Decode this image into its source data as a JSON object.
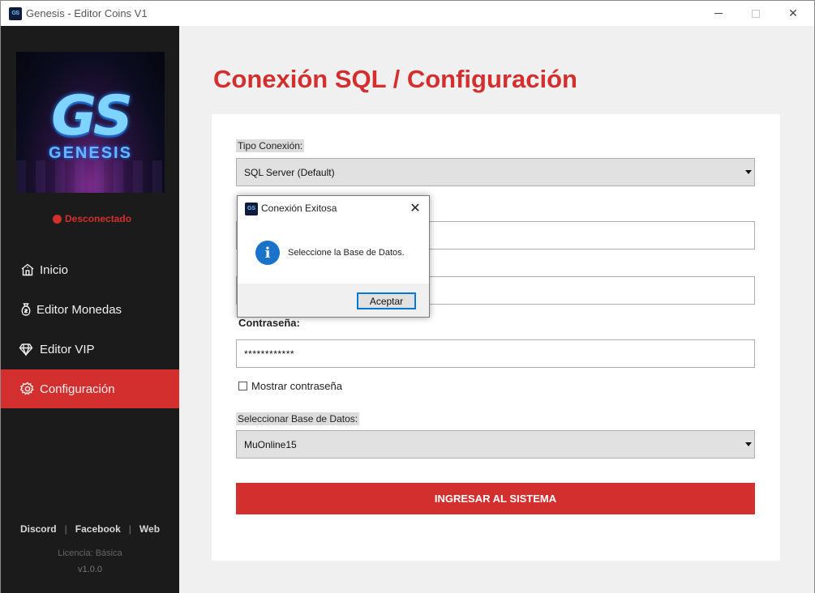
{
  "window": {
    "title": "Genesis - Editor Coins V1",
    "icon_text": "GS"
  },
  "sidebar": {
    "logo": {
      "mark": "GS",
      "name": "GENESIS"
    },
    "status": "Desconectado",
    "status_color": "#d32f2f",
    "items": [
      {
        "label": "Inicio",
        "icon": "home-icon",
        "active": false
      },
      {
        "label": "Editor Monedas",
        "icon": "coin-icon",
        "active": false
      },
      {
        "label": "Editor VIP",
        "icon": "diamond-icon",
        "active": false
      },
      {
        "label": "Configuración",
        "icon": "gear-icon",
        "active": true
      }
    ],
    "links": [
      "Discord",
      "Facebook",
      "Web"
    ],
    "license": "Licencia: Básica",
    "version": "v1.0.0"
  },
  "main": {
    "title": "Conexión SQL / Configuración",
    "accent_color": "#d32f2f",
    "form": {
      "tipo_label": "Tipo Conexión:",
      "tipo_value": "SQL Server (Default)",
      "password_label": "Contraseña:",
      "password_value": "************",
      "show_password_label": "Mostrar contraseña",
      "db_label": "Seleccionar Base de Datos:",
      "db_value": "MuOnline15",
      "submit_label": "INGRESAR AL SISTEMA"
    }
  },
  "dialog": {
    "title": "Conexión Exitosa",
    "message": "Seleccione la Base de Datos.",
    "ok_label": "Aceptar",
    "info_glyph": "i"
  }
}
